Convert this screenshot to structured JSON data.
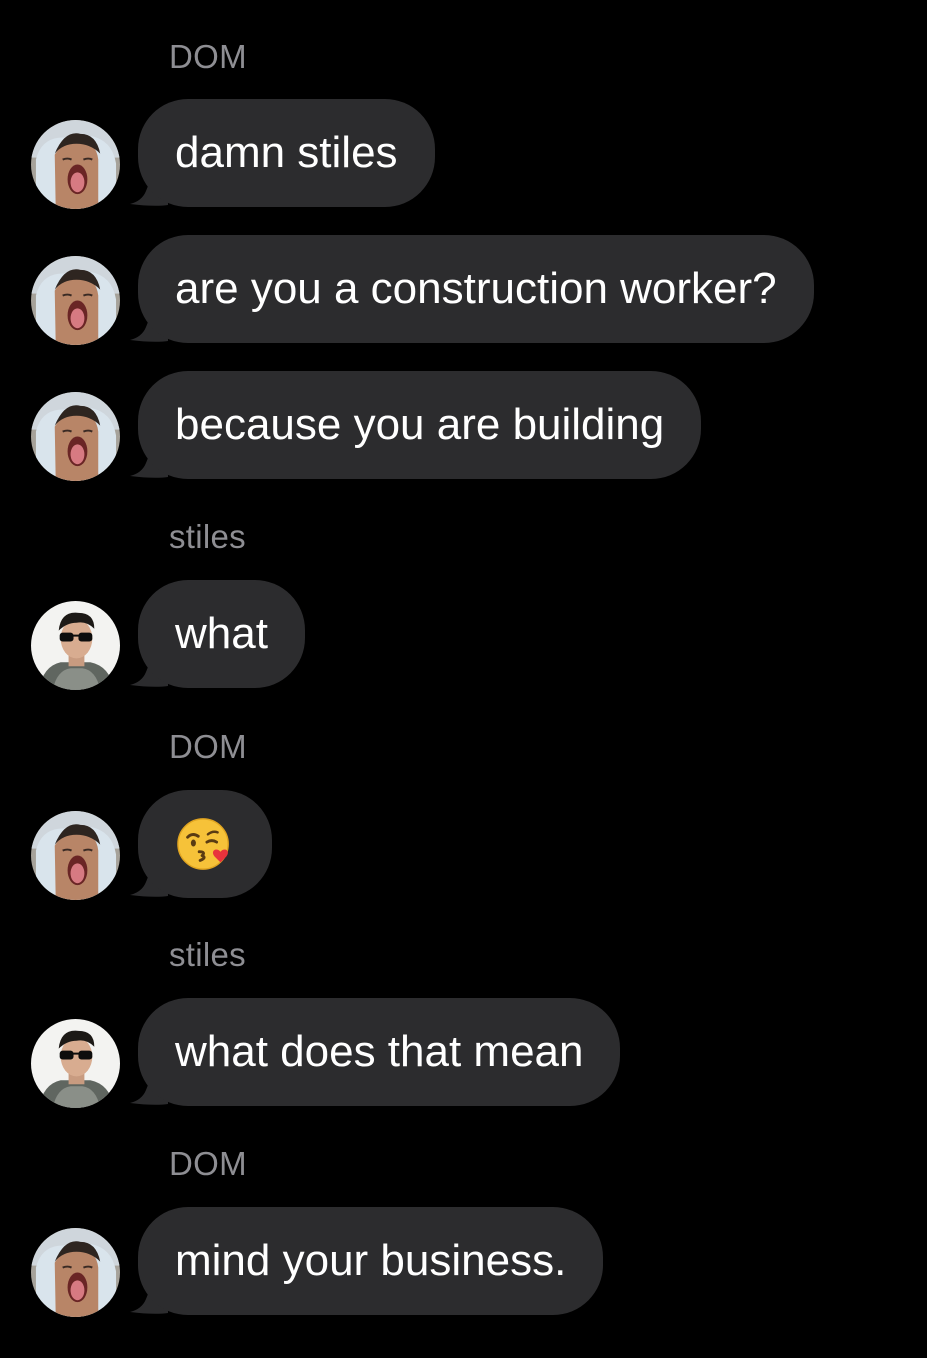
{
  "conversation": {
    "messages": [
      {
        "sender": "DOM",
        "text": "damn stiles",
        "avatar": "dom-avatar"
      },
      {
        "sender": "DOM",
        "text": "are you a construction worker?",
        "avatar": "dom-avatar"
      },
      {
        "sender": "DOM",
        "text": "because you are building",
        "avatar": "dom-avatar"
      },
      {
        "sender": "stiles",
        "text": "what",
        "avatar": "stiles-avatar"
      },
      {
        "sender": "DOM",
        "text": "",
        "emoji": "kissing-face-blowing-kiss",
        "avatar": "dom-avatar"
      },
      {
        "sender": "stiles",
        "text": "what does that mean",
        "avatar": "stiles-avatar"
      },
      {
        "sender": "DOM",
        "text": "mind your business.",
        "avatar": "dom-avatar"
      }
    ],
    "sender_labels": [
      "DOM",
      "stiles",
      "DOM",
      "stiles",
      "DOM"
    ]
  },
  "theme": {
    "background": "#000000",
    "bubble": "#2c2c2e",
    "text": "#ffffff",
    "sender_label": "#8e8e93"
  }
}
